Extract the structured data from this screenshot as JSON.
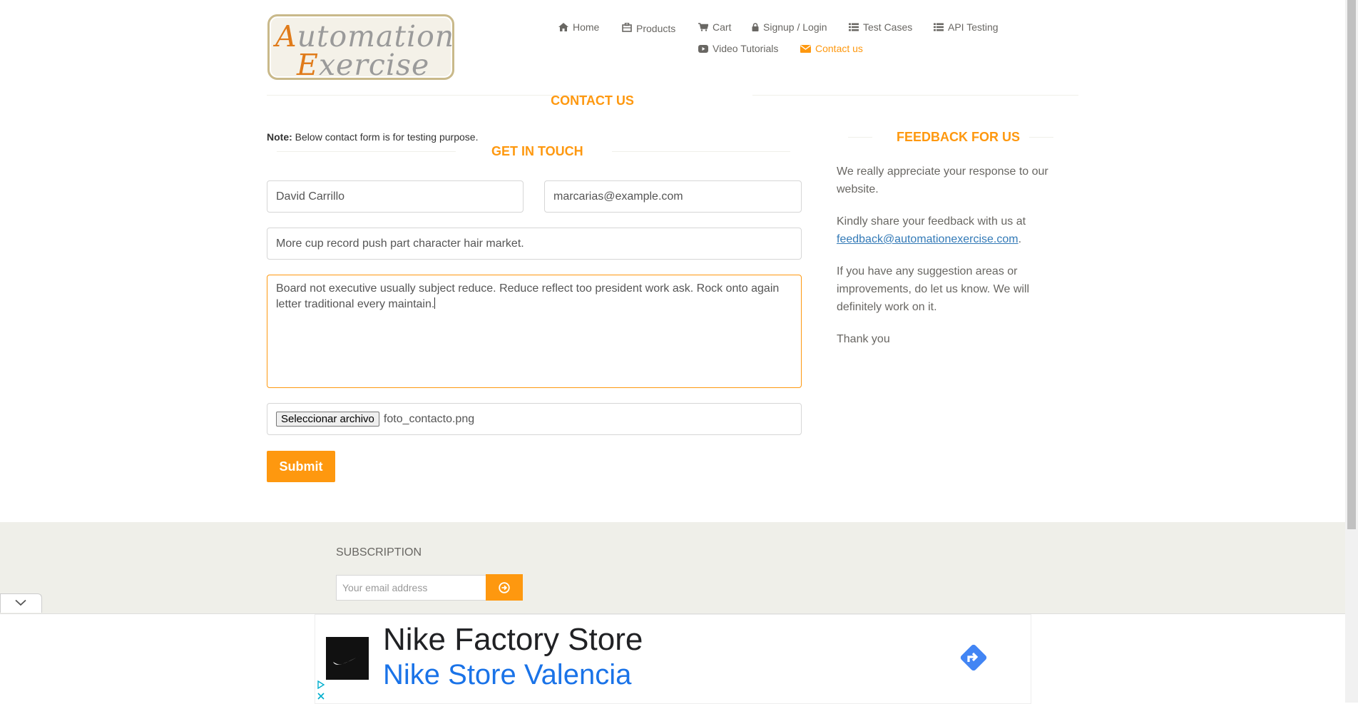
{
  "header": {
    "logo": {
      "line1": "Automation",
      "line2": "Exercise"
    },
    "nav": [
      {
        "label": "Home",
        "icon": "home-icon"
      },
      {
        "label": "Products",
        "icon": "products-icon"
      },
      {
        "label": "Cart",
        "icon": "cart-icon"
      },
      {
        "label": "Signup / Login",
        "icon": "lock-icon"
      },
      {
        "label": "Test Cases",
        "icon": "list-icon"
      },
      {
        "label": "API Testing",
        "icon": "list-icon"
      },
      {
        "label": "Video Tutorials",
        "icon": "youtube-icon"
      },
      {
        "label": "Contact us",
        "icon": "envelope-icon",
        "active": true
      }
    ]
  },
  "main": {
    "title": "CONTACT US",
    "note_label": "Note:",
    "note_text": "Below contact form is for testing purpose.",
    "form_title": "GET IN TOUCH",
    "name_value": "David Carrillo",
    "email_value": "marcarias@example.com",
    "subject_value": "More cup record push part character hair market.",
    "message_value": "Board not executive usually subject reduce. Reduce reflect too president work ask. Rock onto again letter traditional every maintain.",
    "file_button": "Seleccionar archivo",
    "file_name": "foto_contacto.png",
    "submit_label": "Submit"
  },
  "sidebar": {
    "title": "FEEDBACK FOR US",
    "p1": "We really appreciate your response to our website.",
    "p2_before": "Kindly share your feedback with us at",
    "p2_link": "feedback@automationexercise.com",
    "p2_after": ".",
    "p3": "If you have any suggestion areas or improvements, do let us know. We will definitely work on it.",
    "p4": "Thank you"
  },
  "footer": {
    "subscription_title": "SUBSCRIPTION",
    "email_placeholder": "Your email address"
  },
  "ad": {
    "title": "Nike Factory Store",
    "subtitle": "Nike Store Valencia"
  },
  "colors": {
    "accent": "#fe980f",
    "footer_bg": "#efefe9",
    "link": "#337ab7",
    "ad_blue": "#1a73e8"
  }
}
